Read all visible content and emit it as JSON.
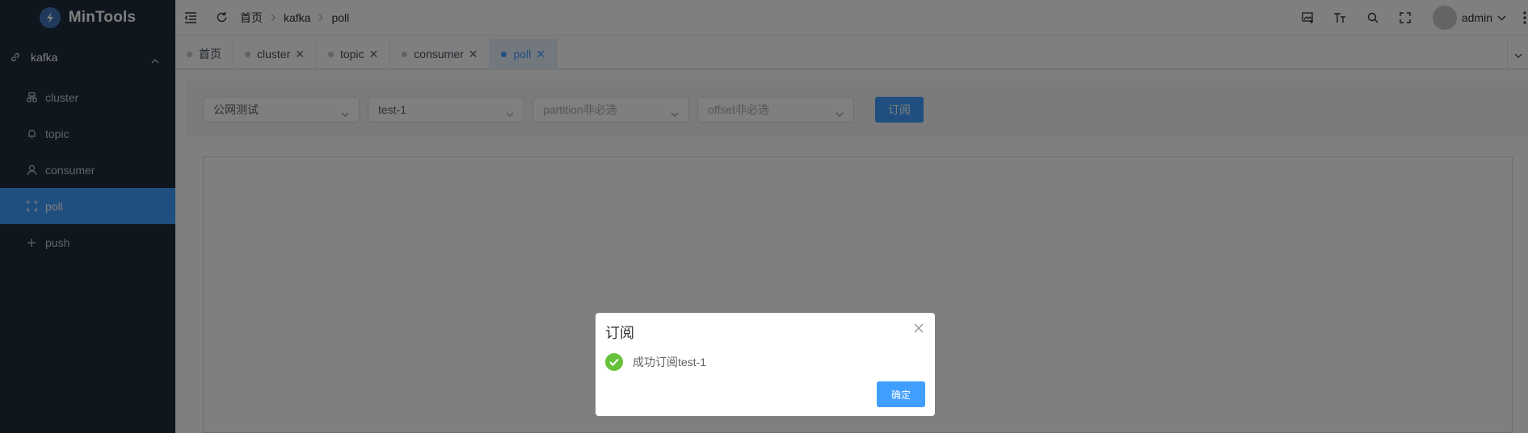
{
  "app": {
    "title": "MinTools"
  },
  "sidebar": {
    "group": {
      "label": "kafka",
      "icon": "link-icon"
    },
    "items": [
      {
        "label": "cluster",
        "icon": "cluster-icon",
        "active": false
      },
      {
        "label": "topic",
        "icon": "bell-icon",
        "active": false
      },
      {
        "label": "consumer",
        "icon": "user-icon",
        "active": false
      },
      {
        "label": "poll",
        "icon": "expand-icon",
        "active": true
      },
      {
        "label": "push",
        "icon": "plus-icon",
        "active": false
      }
    ]
  },
  "navbar": {
    "breadcrumb": [
      "首页",
      "kafka",
      "poll"
    ],
    "user": {
      "name": "admin"
    }
  },
  "tags": [
    {
      "label": "首页",
      "closable": false,
      "active": false
    },
    {
      "label": "cluster",
      "closable": true,
      "active": false
    },
    {
      "label": "topic",
      "closable": true,
      "active": false
    },
    {
      "label": "consumer",
      "closable": true,
      "active": false
    },
    {
      "label": "poll",
      "closable": true,
      "active": true
    }
  ],
  "filters": {
    "env": {
      "value": "公网测试"
    },
    "topic": {
      "value": "test-1"
    },
    "partition": {
      "placeholder": "partition非必选"
    },
    "offset": {
      "placeholder": "offset非必选"
    },
    "subscribe_label": "订阅"
  },
  "dialog": {
    "title": "订阅",
    "message": "成功订阅test-1",
    "confirm_label": "确定",
    "status": "success"
  },
  "colors": {
    "sidebar_bg": "#1f2d3d",
    "primary": "#409eff",
    "success": "#67c23a"
  }
}
